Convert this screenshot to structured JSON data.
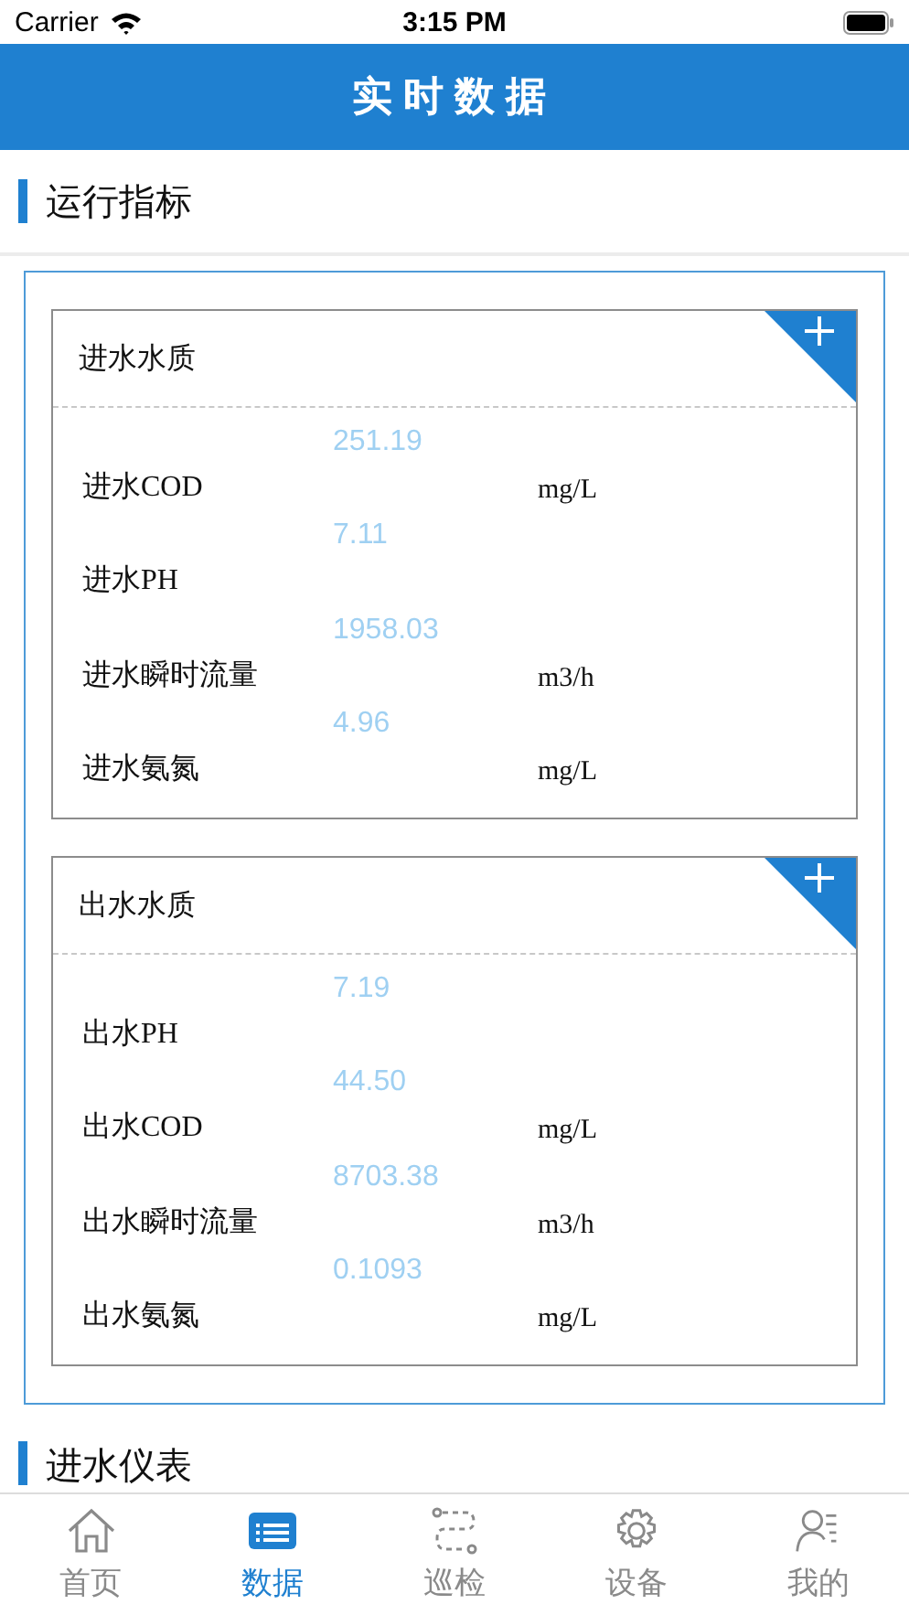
{
  "status_bar": {
    "carrier": "Carrier",
    "time": "3:15 PM"
  },
  "header": {
    "title": "实时数据"
  },
  "sections": [
    {
      "title": "运行指标",
      "cards": [
        {
          "title": "进水水质",
          "rows": [
            {
              "label": "进水COD",
              "value": "251.19",
              "unit": "mg/L"
            },
            {
              "label": "进水PH",
              "value": "7.11"
            },
            {
              "label": "进水瞬时流量",
              "value": "1958.03",
              "unit": "m3/h"
            },
            {
              "label": "进水氨氮",
              "value": "4.96",
              "unit": "mg/L"
            }
          ]
        },
        {
          "title": "出水水质",
          "rows": [
            {
              "label": "出水PH",
              "value": "7.19"
            },
            {
              "label": "出水COD",
              "value": "44.50",
              "unit": "mg/L"
            },
            {
              "label": "出水瞬时流量",
              "value": "8703.38",
              "unit": "m3/h"
            },
            {
              "label": "出水氨氮",
              "value": "0.1093",
              "unit": "mg/L"
            }
          ]
        }
      ]
    },
    {
      "title": "进水仪表"
    }
  ],
  "tab_bar": [
    {
      "kind": "home",
      "label": "首页",
      "selected": false
    },
    {
      "kind": "data",
      "label": "数据",
      "selected": true
    },
    {
      "kind": "patrol",
      "label": "巡检",
      "selected": false
    },
    {
      "kind": "device",
      "label": "设备",
      "selected": false
    },
    {
      "kind": "profile",
      "label": "我的",
      "selected": false
    }
  ]
}
